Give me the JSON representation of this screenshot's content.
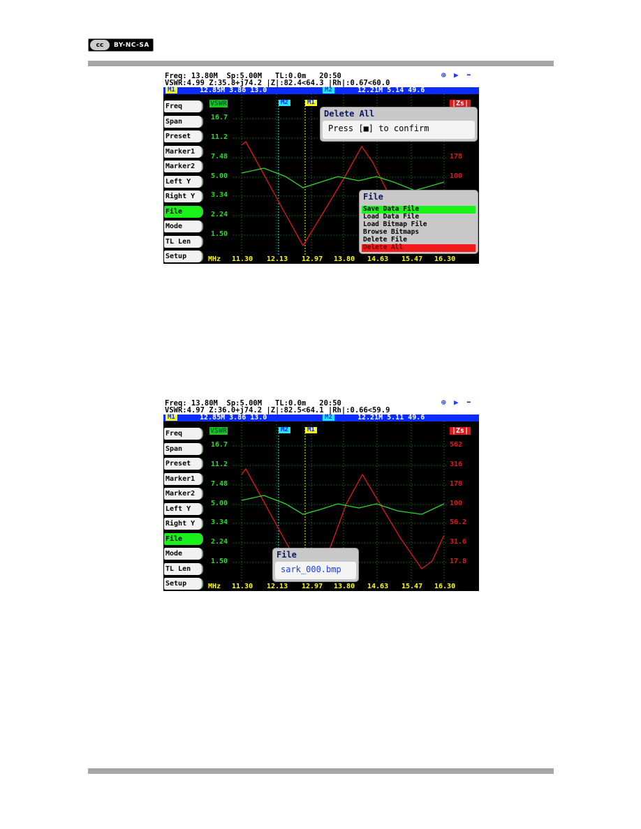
{
  "license_badge": {
    "icon": "cc-icon",
    "text": "BY-NC-SA"
  },
  "screens": [
    {
      "status_line1": "Freq: 13.80M  Sp:5.00M   TL:0.0m   20:50",
      "status_line2": "VSWR:4.99 Z:35.8+j74.2 |Z|:82.4<64.3 |Rh|:0.67<60.0",
      "icons": [
        "globe-icon",
        "play-icon",
        "usb-icon"
      ],
      "marker_bar": {
        "m1_label": "M1",
        "m1_values": "12.85M 3.86 13.0",
        "m2_label": "M2",
        "m2_values": "12.21M 5.14 49.6"
      },
      "menu_buttons": [
        "Freq",
        "Span",
        "Preset",
        "Marker1",
        "Marker2",
        "Left Y",
        "Right Y",
        "File",
        "Mode",
        "TL Len",
        "Setup"
      ],
      "active_button": "File",
      "left_axis_title": "VSWR",
      "right_axis_title": "|Zs|",
      "left_ticks": [
        "16.7",
        "11.2",
        "7.48",
        "5.00",
        "3.34",
        "2.24",
        "1.50"
      ],
      "right_ticks": [
        "",
        "",
        "178",
        "100",
        "",
        "",
        ""
      ],
      "x_unit": "MHz",
      "x_ticks": [
        "11.30",
        "12.13",
        "12.97",
        "13.80",
        "14.63",
        "15.47",
        "16.30"
      ],
      "plot_markers": [
        "M2",
        "M1"
      ],
      "colors": {
        "vswr": "#2bdc2b",
        "zs": "#e01a1a",
        "m1": "#ffff00",
        "m2": "#22e6ff"
      },
      "dialog": {
        "title": "Delete All",
        "message": "Press [■] to confirm"
      },
      "file_menu": {
        "title": "File",
        "items": [
          "Save Data File",
          "Load Data File",
          "Load Bitmap File",
          "Browse Bitmaps",
          "Delete File",
          "Delete All"
        ],
        "selected": "Save Data File",
        "highlighted": "Delete All"
      }
    },
    {
      "status_line1": "Freq: 13.80M  Sp:5.00M   TL:0.0m   20:50",
      "status_line2": "VSWR:4.97 Z:36.0+j74.2 |Z|:82.5<64.1 |Rh|:0.66<59.9",
      "icons": [
        "globe-icon",
        "play-icon",
        "usb-icon"
      ],
      "marker_bar": {
        "m1_label": "M1",
        "m1_values": "12.85M 3.86 13.0",
        "m2_label": "M2",
        "m2_values": "12.21M 5.11 49.6"
      },
      "menu_buttons": [
        "Freq",
        "Span",
        "Preset",
        "Marker1",
        "Marker2",
        "Left Y",
        "Right Y",
        "File",
        "Mode",
        "TL Len",
        "Setup"
      ],
      "active_button": "File",
      "left_axis_title": "VSWR",
      "right_axis_title": "|Zs|",
      "left_ticks": [
        "16.7",
        "11.2",
        "7.48",
        "5.00",
        "3.34",
        "2.24",
        "1.50"
      ],
      "right_ticks": [
        "562",
        "316",
        "178",
        "100",
        "56.2",
        "31.6",
        "17.8"
      ],
      "x_unit": "MHz",
      "x_ticks": [
        "11.30",
        "12.13",
        "12.97",
        "13.80",
        "14.63",
        "15.47",
        "16.30"
      ],
      "plot_markers": [
        "M2",
        "M1"
      ],
      "colors": {
        "vswr": "#2bdc2b",
        "zs": "#e01a1a",
        "m1": "#ffff00",
        "m2": "#22e6ff"
      },
      "filename_dialog": {
        "title": "File",
        "value": "sark_000.bmp"
      }
    }
  ]
}
